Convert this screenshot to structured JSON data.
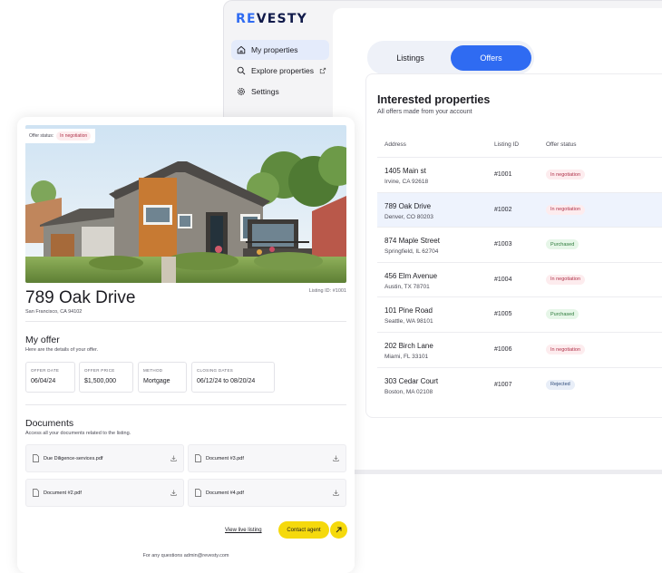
{
  "app": {
    "logo_re": "RE",
    "logo_vesty": "VESTY",
    "nav": [
      {
        "label": "My properties",
        "icon": "home-icon",
        "active": true
      },
      {
        "label": "Explore properties",
        "icon": "search-icon",
        "external": true
      },
      {
        "label": "Settings",
        "icon": "gear-icon"
      }
    ],
    "tabs": [
      {
        "label": "Listings",
        "active": false
      },
      {
        "label": "Offers",
        "active": true
      }
    ],
    "panel": {
      "title": "Interested properties",
      "subtitle": "All offers made from your account",
      "columns": [
        "Address",
        "Listing ID",
        "Offer status"
      ],
      "rows": [
        {
          "street": "1405 Main st",
          "city": "Irvine, CA 92618",
          "listing_id": "#1001",
          "status": "In negotiation",
          "kind": "neg"
        },
        {
          "street": "789 Oak Drive",
          "city": "Denver, CO 80203",
          "listing_id": "#1002",
          "status": "In negotiation",
          "kind": "neg"
        },
        {
          "street": "874 Maple Street",
          "city": "Springfield, IL 62704",
          "listing_id": "#1003",
          "status": "Purchased",
          "kind": "pur"
        },
        {
          "street": "456 Elm Avenue",
          "city": "Austin, TX 78701",
          "listing_id": "#1004",
          "status": "In negotiation",
          "kind": "neg"
        },
        {
          "street": "101 Pine Road",
          "city": "Seattle, WA 98101",
          "listing_id": "#1005",
          "status": "Purchased",
          "kind": "pur"
        },
        {
          "street": "202 Birch Lane",
          "city": "Miami, FL 33101",
          "listing_id": "#1006",
          "status": "In negotiation",
          "kind": "neg"
        },
        {
          "street": "303 Cedar Court",
          "city": "Boston, MA 02108",
          "listing_id": "#1007",
          "status": "Rejected",
          "kind": "rej"
        }
      ]
    }
  },
  "detail": {
    "offer_status_label": "Offer status:",
    "offer_status": "In negotiation",
    "listing_id": "Listing ID: #1001",
    "title": "789 Oak Drive",
    "city": "San Francisco, CA 94102",
    "my_offer": {
      "title": "My offer",
      "subtitle": "Here are the details of your offer.",
      "fields": [
        {
          "label": "Offer date",
          "value": "06/04/24"
        },
        {
          "label": "Offer price",
          "value": "$1,500,000"
        },
        {
          "label": "Method",
          "value": "Mortgage"
        },
        {
          "label": "Closing dates",
          "value": "06/12/24 to 08/20/24"
        }
      ]
    },
    "documents": {
      "title": "Documents",
      "subtitle": "Access all your documents related to the listing.",
      "items": [
        "Due Diligence-services.pdf",
        "Document #3.pdf",
        "Document #2.pdf",
        "Document #4.pdf"
      ]
    },
    "view_live": "View live listing",
    "contact": "Contact agent",
    "footer": "For any questions admin@revesty.com"
  },
  "colors": {
    "accent": "#2f6bf2",
    "contact": "#f5d90c",
    "negotiation": "#b0324a",
    "purchased": "#2c7a3a",
    "rejected": "#2d4a7a"
  }
}
